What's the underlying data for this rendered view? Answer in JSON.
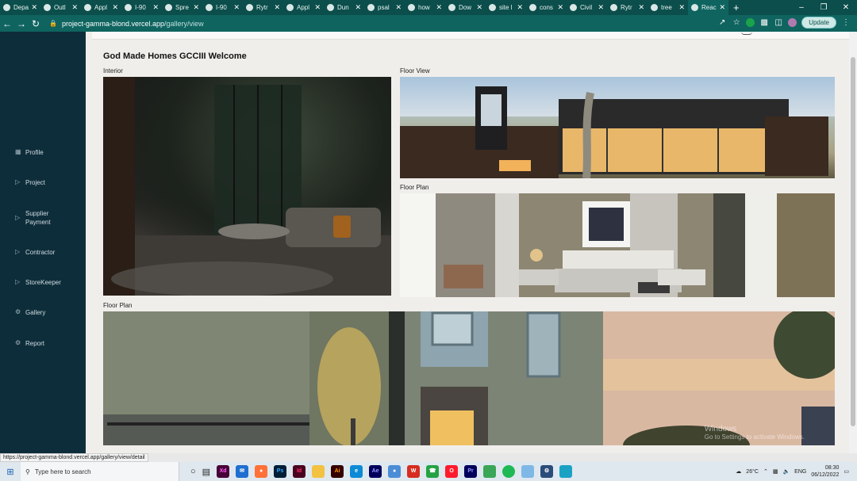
{
  "browser": {
    "tabs": [
      {
        "label": "Depa",
        "icon": "chrome-icon"
      },
      {
        "label": "Outl",
        "icon": "outlook-icon"
      },
      {
        "label": "Appl",
        "icon": "s-icon"
      },
      {
        "label": "I-90",
        "icon": "s-icon"
      },
      {
        "label": "Spre",
        "icon": "sheet-icon"
      },
      {
        "label": "I-90",
        "icon": "globe-icon"
      },
      {
        "label": "Rytr",
        "icon": "rytr-icon"
      },
      {
        "label": "Appl",
        "icon": "form-icon"
      },
      {
        "label": "Dun",
        "icon": "youtube-icon"
      },
      {
        "label": "psal",
        "icon": "google-icon"
      },
      {
        "label": "how",
        "icon": "google-icon"
      },
      {
        "label": "Dow",
        "icon": "link-icon"
      },
      {
        "label": "site l",
        "icon": "google-icon"
      },
      {
        "label": "cons",
        "icon": "google-icon"
      },
      {
        "label": "Civil",
        "icon": "behance-icon"
      },
      {
        "label": "Rytr",
        "icon": "rytr-icon"
      },
      {
        "label": "tree",
        "icon": "google-icon"
      },
      {
        "label": "Reac",
        "icon": "react-icon",
        "active": true
      }
    ],
    "url_host": "project-gamma-blond.vercel.app",
    "url_path": "/gallery/view",
    "update_label": "Update",
    "status_link": "https://project-gamma-blond.vercel.app/gallery/view/detail"
  },
  "sidebar": {
    "items": [
      {
        "label": "Profile",
        "icon": "grid-icon"
      },
      {
        "label": "Project",
        "icon": "tag-icon"
      },
      {
        "label": "Supplier Payment",
        "icon": "tag-icon"
      },
      {
        "label": "Contractor",
        "icon": "tag-icon"
      },
      {
        "label": "StoreKeeper",
        "icon": "tag-icon"
      },
      {
        "label": "Gallery",
        "icon": "gear-icon"
      },
      {
        "label": "Report",
        "icon": "gear-icon"
      }
    ]
  },
  "main": {
    "title": "God Made Homes GCCIII Welcome",
    "gallery": [
      {
        "caption": "Interior"
      },
      {
        "caption": "Floor View"
      },
      {
        "caption": "Floor Plan"
      },
      {
        "caption": "Floor Plan"
      }
    ]
  },
  "watermark": {
    "line1": "Windows",
    "line2": "Go to Settings to activate Windows."
  },
  "taskbar": {
    "search_placeholder": "Type here to search",
    "weather": "26°C",
    "language": "ENG",
    "time": "08:30",
    "date": "06/12/2022"
  },
  "colors": {
    "sidebar_bg": "#0e2d3a",
    "browser_accent": "#0f6460",
    "content_bg": "#f0eeeb"
  }
}
